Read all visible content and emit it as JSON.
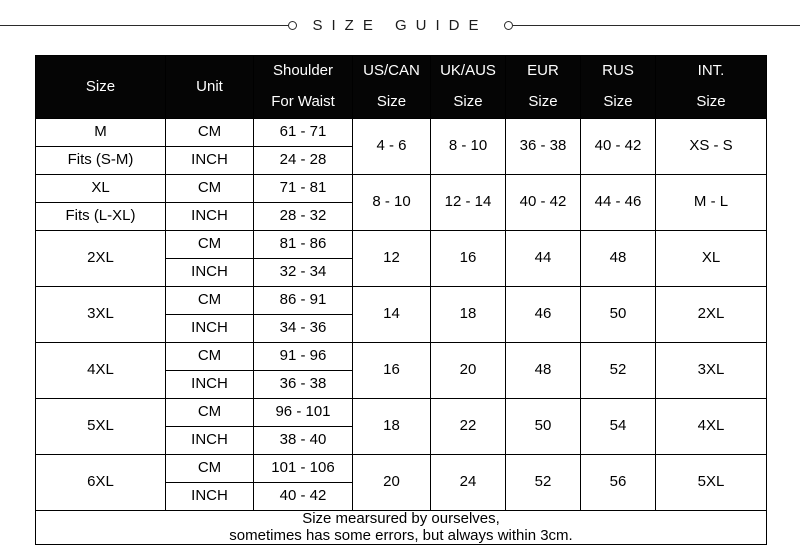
{
  "title": "S I Z E   G U I D E",
  "title_plain": "SIZE GUIDE",
  "columns": {
    "size": "Size",
    "unit": "Unit",
    "shoulder_top": "Shoulder",
    "shoulder_bottom": "For Waist",
    "uscan_top": "US/CAN",
    "uscan_bottom": "Size",
    "ukaus_top": "UK/AUS",
    "ukaus_bottom": "Size",
    "eur_top": "EUR",
    "eur_bottom": "Size",
    "rus_top": "RUS",
    "rus_bottom": "Size",
    "int_top": "INT.",
    "int_bottom": "Size"
  },
  "groups": [
    {
      "size_cm": "M",
      "size_inch": "Fits (S-M)",
      "split_size_cell": true,
      "unit_cm": "CM",
      "unit_inch": "INCH",
      "shoulder_cm": "61 - 71",
      "shoulder_inch": "24 - 28",
      "uscan": "4 - 6",
      "ukaus": "8 - 10",
      "eur": "36 - 38",
      "rus": "40 - 42",
      "int": "XS - S"
    },
    {
      "size_cm": "XL",
      "size_inch": "Fits (L-XL)",
      "split_size_cell": true,
      "unit_cm": "CM",
      "unit_inch": "INCH",
      "shoulder_cm": "71 - 81",
      "shoulder_inch": "28 - 32",
      "uscan": "8 - 10",
      "ukaus": "12 - 14",
      "eur": "40 - 42",
      "rus": "44 - 46",
      "int": "M - L"
    },
    {
      "size_cm": "2XL",
      "size_inch": "",
      "split_size_cell": false,
      "unit_cm": "CM",
      "unit_inch": "INCH",
      "shoulder_cm": "81 - 86",
      "shoulder_inch": "32 - 34",
      "uscan": "12",
      "ukaus": "16",
      "eur": "44",
      "rus": "48",
      "int": "XL"
    },
    {
      "size_cm": "3XL",
      "size_inch": "",
      "split_size_cell": false,
      "unit_cm": "CM",
      "unit_inch": "INCH",
      "shoulder_cm": "86 - 91",
      "shoulder_inch": "34 - 36",
      "uscan": "14",
      "ukaus": "18",
      "eur": "46",
      "rus": "50",
      "int": "2XL"
    },
    {
      "size_cm": "4XL",
      "size_inch": "",
      "split_size_cell": false,
      "unit_cm": "CM",
      "unit_inch": "INCH",
      "shoulder_cm": "91 - 96",
      "shoulder_inch": "36 - 38",
      "uscan": "16",
      "ukaus": "20",
      "eur": "48",
      "rus": "52",
      "int": "3XL"
    },
    {
      "size_cm": "5XL",
      "size_inch": "",
      "split_size_cell": false,
      "unit_cm": "CM",
      "unit_inch": "INCH",
      "shoulder_cm": "96 - 101",
      "shoulder_inch": "38 - 40",
      "uscan": "18",
      "ukaus": "22",
      "eur": "50",
      "rus": "54",
      "int": "4XL"
    },
    {
      "size_cm": "6XL",
      "size_inch": "",
      "split_size_cell": false,
      "unit_cm": "CM",
      "unit_inch": "INCH",
      "shoulder_cm": "101 - 106",
      "shoulder_inch": "40 - 42",
      "uscan": "20",
      "ukaus": "24",
      "eur": "52",
      "rus": "56",
      "int": "5XL"
    }
  ],
  "footer": {
    "line1": "Size mearsured by ourselves,",
    "line2": "sometimes has some errors, but always within 3cm."
  },
  "colors": {
    "header_bg": "#050505",
    "header_text": "#ffffff",
    "border": "#000000",
    "page_bg": "#ffffff",
    "title_text": "#1c1c1c"
  }
}
